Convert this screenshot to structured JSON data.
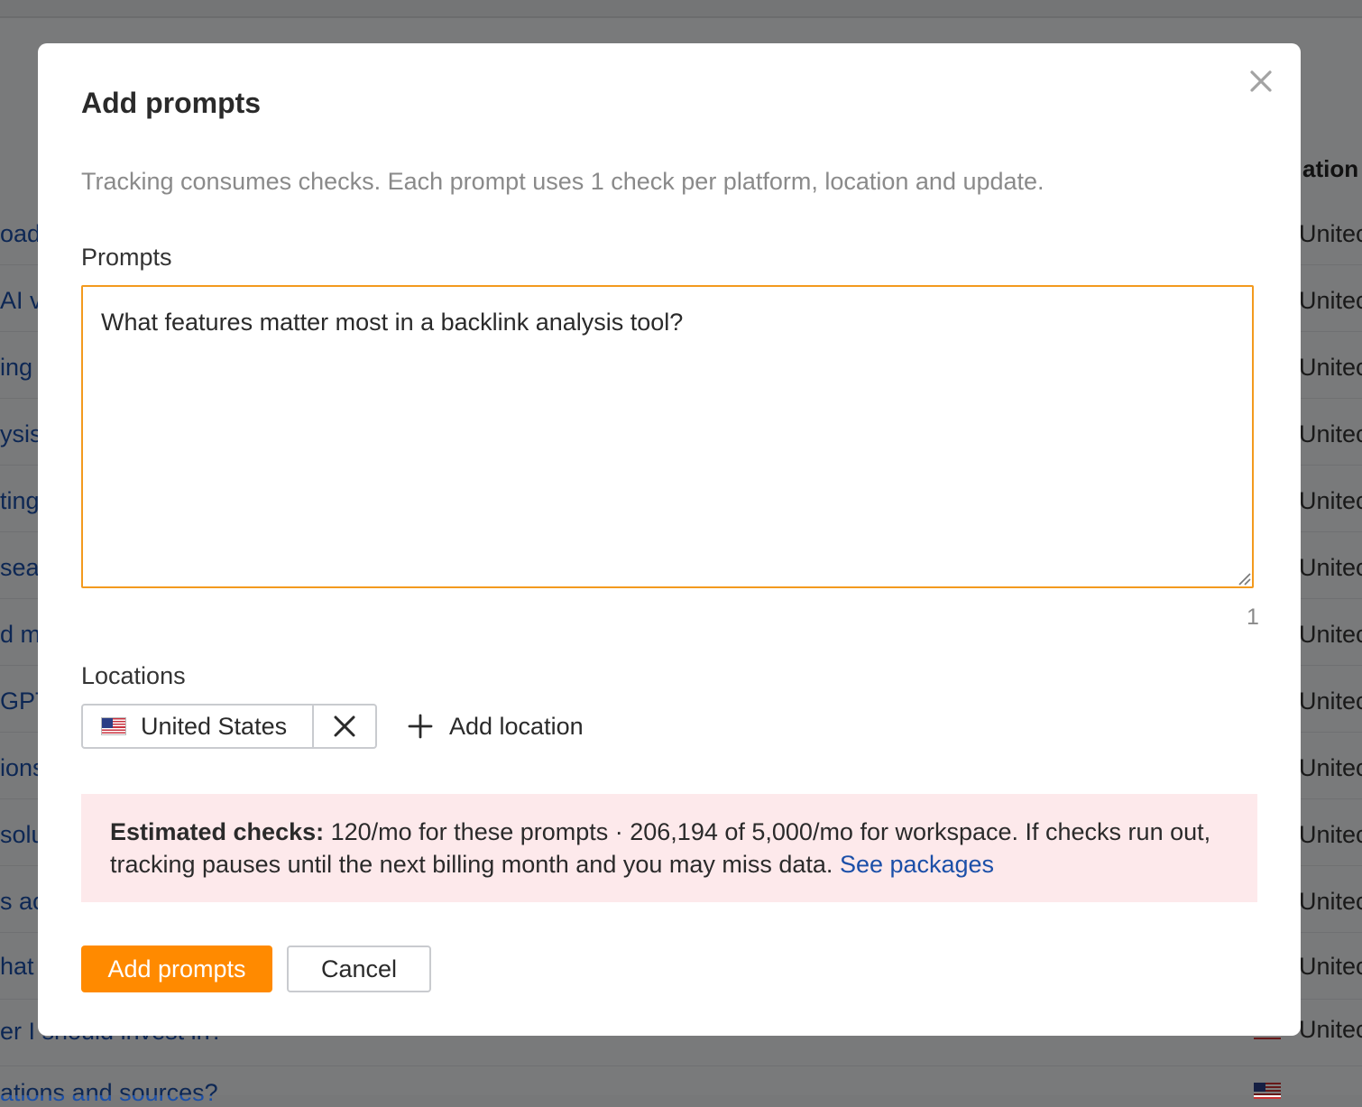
{
  "modal": {
    "title": "Add prompts",
    "subtitle": "Tracking consumes checks. Each prompt uses 1 check per platform, location and update.",
    "prompts_label": "Prompts",
    "prompts_value": "What features matter most in a backlink analysis tool?",
    "prompt_count": "1",
    "locations_label": "Locations",
    "location_chip": {
      "label": "United States",
      "flag": "us-flag-icon"
    },
    "add_location_label": "Add location",
    "notice": {
      "bold": "Estimated checks:",
      "text": " 120/mo for these prompts · 206,194 of 5,000/mo for workspace. If checks run out, tracking pauses until the next billing month and you may miss data. ",
      "link": "See packages"
    },
    "primary_button": "Add prompts",
    "cancel_button": "Cancel"
  },
  "background": {
    "column_header": "ation",
    "left_fragments": [
      "oad",
      "AI v",
      "ing ",
      "ysis",
      "ting",
      "sea",
      "d m",
      "GPT",
      "ions",
      "solu",
      "s ac",
      "hat "
    ],
    "right_values": [
      "Unitec",
      "Unitec",
      "Unitec",
      "Unitec",
      "Unitec",
      "Unitec",
      "Unitec",
      "Unitec",
      "Unitec",
      "Unitec",
      "Unitec",
      "Unitec",
      "Unitec"
    ],
    "bottom_row_1": "er I should invest in? ",
    "bottom_row_2": "ations and sources? "
  },
  "colors": {
    "accent": "#ff8a00",
    "focus_border": "#f39a1e",
    "link": "#1b4fa8",
    "notice_bg": "#fde9eb"
  }
}
